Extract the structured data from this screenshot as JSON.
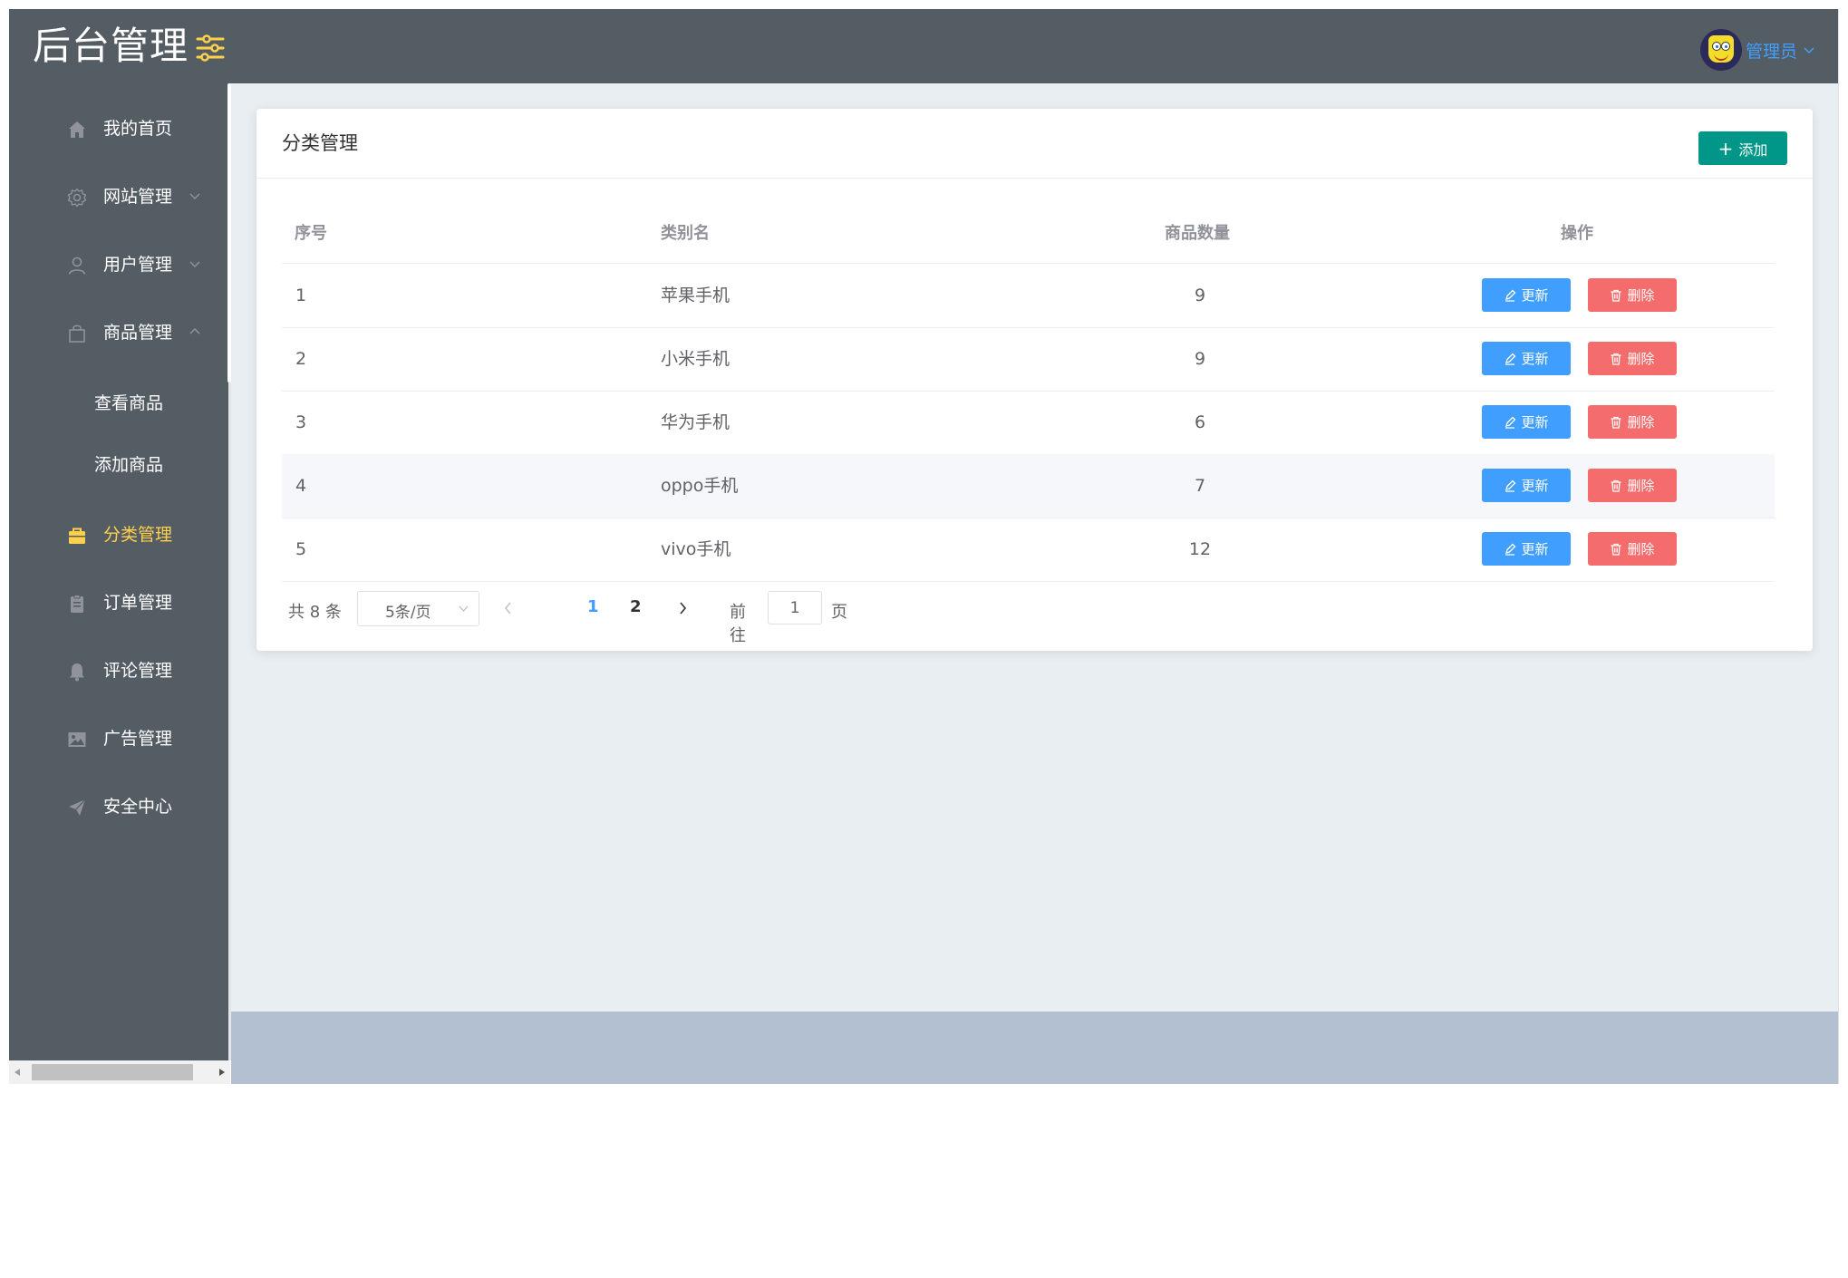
{
  "header": {
    "title": "后台管理",
    "user_name": "管理员"
  },
  "sidebar": {
    "items": [
      {
        "label": "我的首页",
        "icon": "home-icon"
      },
      {
        "label": "网站管理",
        "icon": "gear-icon"
      },
      {
        "label": "用户管理",
        "icon": "user-icon"
      },
      {
        "label": "商品管理",
        "icon": "bag-icon"
      },
      {
        "label": "分类管理",
        "icon": "briefcase-icon",
        "active": true
      },
      {
        "label": "订单管理",
        "icon": "clipboard-icon"
      },
      {
        "label": "评论管理",
        "icon": "bell-icon"
      },
      {
        "label": "广告管理",
        "icon": "picture-icon"
      },
      {
        "label": "安全中心",
        "icon": "send-icon"
      }
    ],
    "sub_items": [
      "查看商品",
      "添加商品"
    ]
  },
  "card": {
    "title": "分类管理",
    "add_label": "添加"
  },
  "table": {
    "headers": [
      "序号",
      "类别名",
      "商品数量",
      "操作"
    ],
    "rows": [
      {
        "id": "1",
        "name": "苹果手机",
        "count": "9"
      },
      {
        "id": "2",
        "name": "小米手机",
        "count": "9"
      },
      {
        "id": "3",
        "name": "华为手机",
        "count": "6"
      },
      {
        "id": "4",
        "name": "oppo手机",
        "count": "7"
      },
      {
        "id": "5",
        "name": "vivo手机",
        "count": "12"
      }
    ],
    "update_label": "更新",
    "delete_label": "删除"
  },
  "pagination": {
    "total_text": "共 8 条",
    "page_size": "5条/页",
    "pages": [
      "1",
      "2"
    ],
    "current_page": "1",
    "goto_prefix": "前往",
    "goto_value": "1",
    "goto_suffix": "页"
  },
  "colors": {
    "header_bg": "#545c64",
    "active_menu": "#ffd04b",
    "primary": "#409eff",
    "danger": "#f56c6c",
    "add_button": "#009688"
  }
}
